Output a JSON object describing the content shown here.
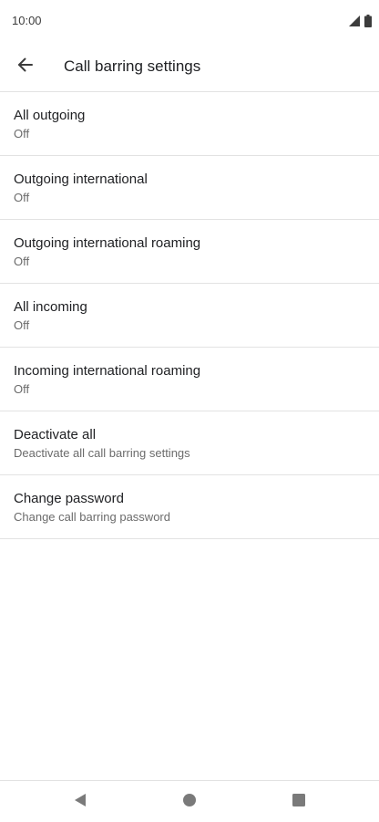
{
  "status_bar": {
    "time": "10:00"
  },
  "header": {
    "title": "Call barring settings"
  },
  "items": [
    {
      "title": "All outgoing",
      "subtitle": "Off"
    },
    {
      "title": "Outgoing international",
      "subtitle": "Off"
    },
    {
      "title": "Outgoing international roaming",
      "subtitle": "Off"
    },
    {
      "title": "All incoming",
      "subtitle": "Off"
    },
    {
      "title": "Incoming international roaming",
      "subtitle": "Off"
    },
    {
      "title": "Deactivate all",
      "subtitle": "Deactivate all call barring settings"
    },
    {
      "title": "Change password",
      "subtitle": "Change call barring password"
    }
  ],
  "icons": {
    "back": "arrow-back-icon",
    "signal": "signal-icon",
    "battery": "battery-icon",
    "nav_back": "nav-back-icon",
    "nav_home": "nav-home-icon",
    "nav_recents": "nav-recents-icon"
  },
  "colors": {
    "text_primary": "#202124",
    "text_secondary": "#6b6b6b",
    "divider": "#e2e2e2",
    "nav_icon": "#7a7a7a"
  }
}
